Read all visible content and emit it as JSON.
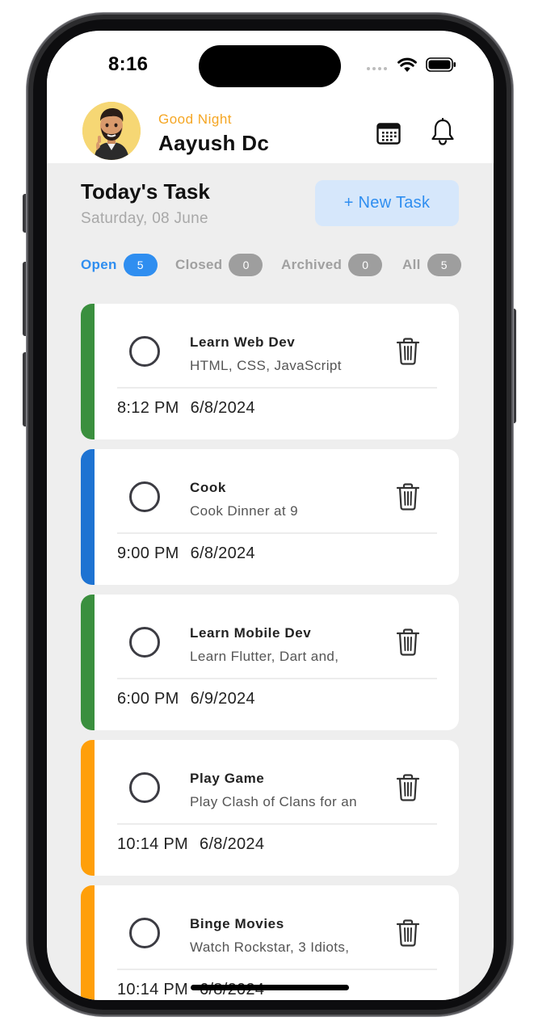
{
  "status_bar": {
    "time": "8:16"
  },
  "header": {
    "greeting": "Good Night",
    "user_name": "Aayush Dc",
    "avatar_icon": "memoji-avatar-icon",
    "calendar_icon": "calendar-icon",
    "notification_icon": "bell-icon"
  },
  "section": {
    "title": "Today's Task",
    "date": "Saturday, 08 June",
    "new_task_label": "+ New Task"
  },
  "tabs": [
    {
      "label": "Open",
      "count": "5",
      "active": true
    },
    {
      "label": "Closed",
      "count": "0",
      "active": false
    },
    {
      "label": "Archived",
      "count": "0",
      "active": false
    },
    {
      "label": "All",
      "count": "5",
      "active": false
    }
  ],
  "tasks": [
    {
      "title": "Learn Web Dev",
      "description": "HTML, CSS, JavaScript",
      "time": "8:12 PM",
      "date": "6/8/2024",
      "color": "#3a8f3e"
    },
    {
      "title": "Cook",
      "description": "Cook Dinner at 9",
      "time": "9:00 PM",
      "date": "6/8/2024",
      "color": "#1e73d2"
    },
    {
      "title": "Learn Mobile Dev",
      "description": "Learn Flutter, Dart and,",
      "time": "6:00 PM",
      "date": "6/9/2024",
      "color": "#3a8f3e"
    },
    {
      "title": "Play Game",
      "description": "Play Clash of Clans for an",
      "time": "10:14 PM",
      "date": "6/8/2024",
      "color": "#ff9f0a"
    },
    {
      "title": "Binge Movies",
      "description": "Watch Rockstar, 3 Idiots,",
      "time": "10:14 PM",
      "date": "6/8/2024",
      "color": "#ff9f0a"
    }
  ],
  "colors": {
    "accent_blue": "#2f8ef0",
    "greeting_orange": "#f5a623",
    "badge_gray": "#9e9e9e",
    "background": "#eeeeee"
  }
}
